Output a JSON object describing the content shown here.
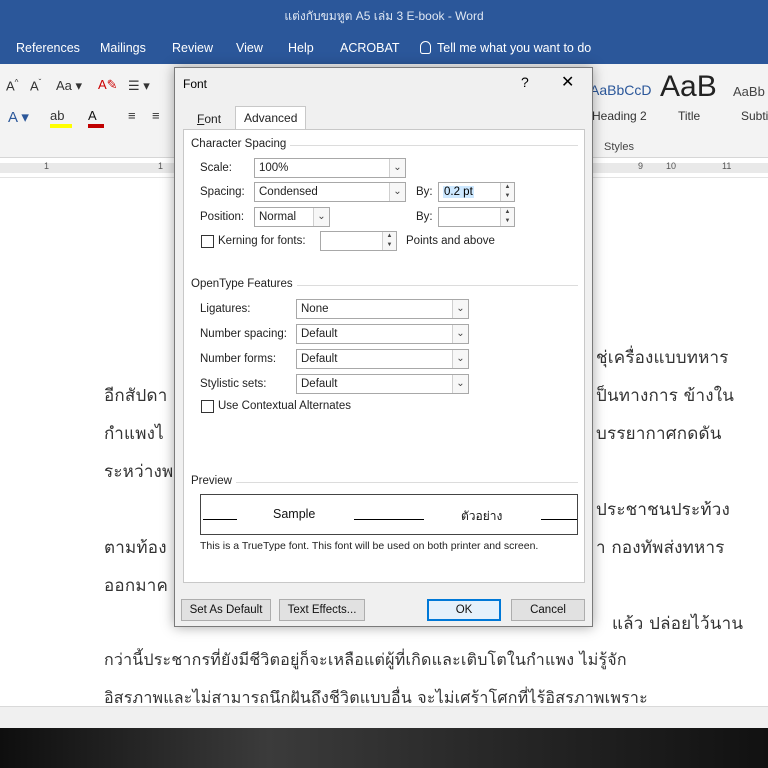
{
  "window": {
    "title": "แต่งกับขมหูต A5 เล่ม 3 E-book  -  Word"
  },
  "menu": {
    "items": [
      "References",
      "Mailings",
      "Review",
      "View",
      "Help",
      "ACROBAT"
    ],
    "tell_me": "Tell me what you want to do"
  },
  "ribbon": {
    "styles": [
      {
        "sample": "AaBbCcD",
        "name": "Heading 2"
      },
      {
        "sample": "AaB",
        "name": "Title"
      },
      {
        "sample": "AaBb",
        "name": "Subti"
      }
    ],
    "styles_group": "Styles",
    "font_color": "#c00000",
    "highlight_color": "#ffff00"
  },
  "ruler": {
    "left_ticks": [
      "1",
      "1"
    ],
    "right_ticks": [
      "9",
      "10",
      "11"
    ]
  },
  "document": {
    "lines": [
      "ชุ่เครื่องแบบทหาร",
      "อีกสัปดา",
      "ป็นทางการ ข้างใน",
      "กำแพงไ",
      "บรรยากาศกดดัน",
      "ระหว่างพ",
      "ประชาชนประท้วง",
      "ตามท้อง",
      "า กองทัพส่งทหาร",
      "ออกมาค",
      "แล้ว ปล่อยไว้นาน",
      "กว่านี้ประชากรที่ยังมีชีวิตอยู่ก็จะเหลือแต่ผู้ที่เกิดและเติบโตในกำแพง ไม่รู้จัก",
      "อิสรภาพและไม่สามารถนึกฝันถึงชีวิตแบบอื่น จะไม่เศร้าโศกที่ไร้อิสรภาพเพราะ"
    ]
  },
  "dialog": {
    "title": "Font",
    "help": "?",
    "close": "✕",
    "tabs": [
      "Font",
      "Advanced"
    ],
    "active_tab": "Advanced",
    "character_spacing": {
      "heading": "Character Spacing",
      "scale_label": "Scale:",
      "scale_value": "100%",
      "spacing_label": "Spacing:",
      "spacing_value": "Condensed",
      "spacing_by_label": "By:",
      "spacing_by_value": "0.2 pt",
      "position_label": "Position:",
      "position_value": "Normal",
      "position_by_label": "By:",
      "position_by_value": "",
      "kerning_label": "Kerning for fonts:",
      "kerning_checked": false,
      "kerning_value": "",
      "kerning_suffix": "Points and above"
    },
    "opentype": {
      "heading": "OpenType Features",
      "ligatures_label": "Ligatures:",
      "ligatures_value": "None",
      "number_spacing_label": "Number spacing:",
      "number_spacing_value": "Default",
      "number_forms_label": "Number forms:",
      "number_forms_value": "Default",
      "stylistic_sets_label": "Stylistic sets:",
      "stylistic_sets_value": "Default",
      "contextual_label": "Use Contextual Alternates",
      "contextual_checked": false
    },
    "preview": {
      "heading": "Preview",
      "sample": "Sample",
      "sample_thai": "ตัวอย่าง",
      "note": "This is a TrueType font. This font will be used on both printer and screen."
    },
    "buttons": {
      "set_default": "Set As Default",
      "text_effects": "Text Effects...",
      "ok": "OK",
      "cancel": "Cancel"
    }
  }
}
